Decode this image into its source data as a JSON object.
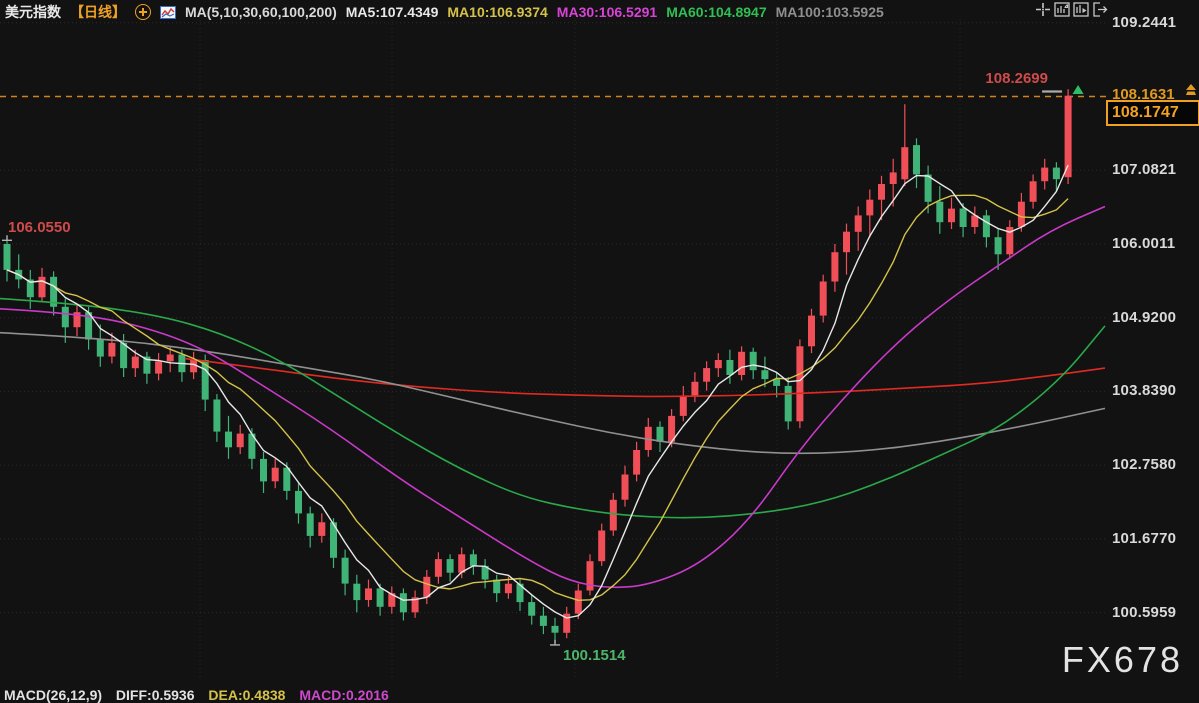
{
  "header": {
    "symbol": "美元指数",
    "period": "【日线】",
    "ma_group": "MA(5,10,30,60,100,200)",
    "ma5": "MA5:107.4349",
    "ma10": "MA10:106.9374",
    "ma30": "MA30:106.5291",
    "ma60": "MA60:104.8947",
    "ma100": "MA100:103.5925"
  },
  "colors": {
    "accent_orange": "#f0a125",
    "ma5": "#e8e8e8",
    "ma10": "#d4c24a",
    "ma30": "#c93ac9",
    "ma60": "#2aa94a",
    "ma100": "#909090",
    "ma200": "#e02a22",
    "candle_up": "#f14f58",
    "candle_down": "#40b376"
  },
  "toolbar": {
    "icons": [
      "crosshair",
      "indicator-panel",
      "playback",
      "exit"
    ]
  },
  "axis": {
    "alert_label": "108.1631",
    "price_box": "108.1747"
  },
  "footer": {
    "macd_label": "MACD(26,12,9)",
    "diff": "DIFF:0.5936",
    "dea": "DEA:0.4838",
    "macd": "MACD:0.2016"
  },
  "watermark": "FX678",
  "chart_data": {
    "type": "candlestick",
    "title": "美元指数 日线 (US Dollar Index, daily)",
    "ylim": [
      100.0,
      109.6
    ],
    "grid": true,
    "legend_position": "top",
    "y_ticks": [
      {
        "label": "109.2441",
        "price": 109.2441
      },
      {
        "label": "108.1631",
        "price": 108.1631
      },
      {
        "label": "107.0821",
        "price": 107.0821
      },
      {
        "label": "106.0011",
        "price": 106.0011
      },
      {
        "label": "104.9200",
        "price": 104.92
      },
      {
        "label": "103.8390",
        "price": 103.839
      },
      {
        "label": "102.7580",
        "price": 102.758
      },
      {
        "label": "101.6770",
        "price": 101.677
      },
      {
        "label": "100.5959",
        "price": 100.5959
      }
    ],
    "price_line": {
      "price": 108.1631,
      "label": "108.1631"
    },
    "last_price": {
      "value": 108.1747,
      "label": "108.1747"
    },
    "colors": {
      "up": "#f14f58",
      "down": "#40b376"
    },
    "candles": [
      [
        106.0,
        106.055,
        105.45,
        105.62
      ],
      [
        105.62,
        105.85,
        105.35,
        105.48
      ],
      [
        105.48,
        105.62,
        105.05,
        105.22
      ],
      [
        105.22,
        105.65,
        105.15,
        105.52
      ],
      [
        105.52,
        105.6,
        104.95,
        105.08
      ],
      [
        105.08,
        105.2,
        104.55,
        104.78
      ],
      [
        104.78,
        105.1,
        104.65,
        105.0
      ],
      [
        105.0,
        105.08,
        104.45,
        104.6
      ],
      [
        104.6,
        104.82,
        104.2,
        104.35
      ],
      [
        104.35,
        104.7,
        104.25,
        104.55
      ],
      [
        104.55,
        104.68,
        104.05,
        104.18
      ],
      [
        104.18,
        104.45,
        104.05,
        104.35
      ],
      [
        104.35,
        104.42,
        103.95,
        104.1
      ],
      [
        104.1,
        104.4,
        104.0,
        104.28
      ],
      [
        104.28,
        104.5,
        104.12,
        104.38
      ],
      [
        104.38,
        104.45,
        103.98,
        104.12
      ],
      [
        104.12,
        104.42,
        104.02,
        104.3
      ],
      [
        104.3,
        104.38,
        103.55,
        103.72
      ],
      [
        103.72,
        103.8,
        103.1,
        103.25
      ],
      [
        103.25,
        103.48,
        102.85,
        103.02
      ],
      [
        103.02,
        103.35,
        102.92,
        103.22
      ],
      [
        103.22,
        103.3,
        102.7,
        102.85
      ],
      [
        102.85,
        102.95,
        102.35,
        102.52
      ],
      [
        102.52,
        102.85,
        102.42,
        102.72
      ],
      [
        102.72,
        102.8,
        102.25,
        102.38
      ],
      [
        102.38,
        102.5,
        101.9,
        102.05
      ],
      [
        102.05,
        102.15,
        101.55,
        101.72
      ],
      [
        101.72,
        102.05,
        101.62,
        101.92
      ],
      [
        101.92,
        101.98,
        101.25,
        101.4
      ],
      [
        101.4,
        101.52,
        100.85,
        101.02
      ],
      [
        101.02,
        101.15,
        100.6,
        100.78
      ],
      [
        100.78,
        101.08,
        100.68,
        100.95
      ],
      [
        100.95,
        101.02,
        100.55,
        100.68
      ],
      [
        100.68,
        100.98,
        100.58,
        100.88
      ],
      [
        100.88,
        100.95,
        100.48,
        100.6
      ],
      [
        100.6,
        100.92,
        100.52,
        100.82
      ],
      [
        100.82,
        101.22,
        100.72,
        101.12
      ],
      [
        101.12,
        101.48,
        101.02,
        101.38
      ],
      [
        101.38,
        101.45,
        101.05,
        101.18
      ],
      [
        101.18,
        101.55,
        101.1,
        101.45
      ],
      [
        101.45,
        101.52,
        101.15,
        101.28
      ],
      [
        101.28,
        101.38,
        100.95,
        101.08
      ],
      [
        101.08,
        101.15,
        100.75,
        100.88
      ],
      [
        100.88,
        101.12,
        100.8,
        101.02
      ],
      [
        101.02,
        101.08,
        100.62,
        100.75
      ],
      [
        100.75,
        100.85,
        100.42,
        100.55
      ],
      [
        100.55,
        100.68,
        100.28,
        100.4
      ],
      [
        100.4,
        100.52,
        100.1514,
        100.3
      ],
      [
        100.3,
        100.68,
        100.22,
        100.58
      ],
      [
        100.58,
        101.02,
        100.5,
        100.92
      ],
      [
        100.92,
        101.45,
        100.85,
        101.35
      ],
      [
        101.35,
        101.9,
        101.28,
        101.8
      ],
      [
        101.8,
        102.35,
        101.72,
        102.25
      ],
      [
        102.25,
        102.75,
        102.15,
        102.62
      ],
      [
        102.62,
        103.1,
        102.52,
        102.98
      ],
      [
        102.98,
        103.45,
        102.88,
        103.32
      ],
      [
        103.32,
        103.4,
        102.95,
        103.1
      ],
      [
        103.1,
        103.58,
        103.02,
        103.48
      ],
      [
        103.48,
        103.92,
        103.4,
        103.78
      ],
      [
        103.78,
        104.12,
        103.68,
        103.98
      ],
      [
        103.98,
        104.28,
        103.85,
        104.18
      ],
      [
        104.18,
        104.4,
        104.05,
        104.3
      ],
      [
        104.3,
        104.45,
        103.95,
        104.08
      ],
      [
        104.08,
        104.5,
        104.0,
        104.42
      ],
      [
        104.42,
        104.48,
        104.02,
        104.15
      ],
      [
        104.15,
        104.35,
        103.9,
        104.02
      ],
      [
        104.02,
        104.12,
        103.75,
        103.92
      ],
      [
        103.92,
        104.05,
        103.28,
        103.4
      ],
      [
        103.4,
        104.6,
        103.3,
        104.5
      ],
      [
        104.5,
        105.05,
        104.4,
        104.95
      ],
      [
        104.95,
        105.55,
        104.85,
        105.45
      ],
      [
        105.45,
        106.0,
        105.3,
        105.88
      ],
      [
        105.88,
        106.3,
        105.55,
        106.18
      ],
      [
        106.18,
        106.55,
        105.9,
        106.42
      ],
      [
        106.42,
        106.8,
        106.1,
        106.65
      ],
      [
        106.65,
        107.0,
        106.35,
        106.88
      ],
      [
        106.88,
        107.25,
        106.55,
        107.05
      ],
      [
        106.95,
        108.05,
        106.85,
        107.42
      ],
      [
        107.45,
        107.55,
        106.82,
        107.02
      ],
      [
        107.02,
        107.15,
        106.45,
        106.62
      ],
      [
        106.62,
        106.85,
        106.15,
        106.32
      ],
      [
        106.32,
        106.68,
        106.22,
        106.52
      ],
      [
        106.52,
        106.6,
        106.1,
        106.25
      ],
      [
        106.25,
        106.55,
        106.15,
        106.42
      ],
      [
        106.42,
        106.5,
        105.95,
        106.1
      ],
      [
        106.1,
        106.22,
        105.62,
        105.85
      ],
      [
        105.85,
        106.35,
        105.78,
        106.25
      ],
      [
        106.25,
        106.75,
        106.18,
        106.62
      ],
      [
        106.62,
        107.02,
        106.52,
        106.92
      ],
      [
        106.92,
        107.25,
        106.8,
        107.12
      ],
      [
        107.12,
        107.2,
        106.78,
        106.95
      ],
      [
        106.98,
        108.2699,
        106.88,
        108.1747
      ]
    ],
    "computed_ma": [
      {
        "name": "MA10",
        "window": 10,
        "color": "#d4c24a"
      },
      {
        "name": "MA5",
        "window": 5,
        "color": "#e8e8e8"
      }
    ],
    "ma_overlays": [
      {
        "name": "MA200",
        "color": "#e02a22",
        "points": [
          [
            185,
            104.32
          ],
          [
            260,
            104.18
          ],
          [
            340,
            104.02
          ],
          [
            420,
            103.9
          ],
          [
            500,
            103.82
          ],
          [
            580,
            103.78
          ],
          [
            660,
            103.76
          ],
          [
            740,
            103.78
          ],
          [
            820,
            103.82
          ],
          [
            900,
            103.88
          ],
          [
            980,
            103.95
          ],
          [
            1040,
            104.05
          ],
          [
            1105,
            104.18
          ]
        ]
      },
      {
        "name": "MA100",
        "color": "#909090",
        "points": [
          [
            0,
            104.7
          ],
          [
            100,
            104.62
          ],
          [
            200,
            104.45
          ],
          [
            300,
            104.2
          ],
          [
            380,
            104.0
          ],
          [
            460,
            103.72
          ],
          [
            540,
            103.45
          ],
          [
            620,
            103.2
          ],
          [
            700,
            103.02
          ],
          [
            780,
            102.92
          ],
          [
            860,
            102.95
          ],
          [
            940,
            103.1
          ],
          [
            1020,
            103.32
          ],
          [
            1105,
            103.59
          ]
        ]
      },
      {
        "name": "MA60",
        "color": "#2aa94a",
        "points": [
          [
            0,
            105.2
          ],
          [
            80,
            105.12
          ],
          [
            160,
            104.95
          ],
          [
            220,
            104.7
          ],
          [
            280,
            104.3
          ],
          [
            340,
            103.75
          ],
          [
            400,
            103.2
          ],
          [
            460,
            102.7
          ],
          [
            520,
            102.3
          ],
          [
            580,
            102.1
          ],
          [
            640,
            102.0
          ],
          [
            700,
            101.98
          ],
          [
            760,
            102.05
          ],
          [
            820,
            102.2
          ],
          [
            880,
            102.5
          ],
          [
            940,
            102.9
          ],
          [
            1000,
            103.3
          ],
          [
            1060,
            104.0
          ],
          [
            1105,
            104.8
          ]
        ]
      },
      {
        "name": "MA30",
        "color": "#c93ac9",
        "points": [
          [
            0,
            105.05
          ],
          [
            60,
            105.0
          ],
          [
            130,
            104.85
          ],
          [
            200,
            104.5
          ],
          [
            260,
            103.95
          ],
          [
            330,
            103.3
          ],
          [
            400,
            102.55
          ],
          [
            470,
            101.9
          ],
          [
            530,
            101.35
          ],
          [
            570,
            101.05
          ],
          [
            610,
            100.95
          ],
          [
            650,
            101.0
          ],
          [
            700,
            101.3
          ],
          [
            750,
            101.95
          ],
          [
            800,
            103.0
          ],
          [
            850,
            103.85
          ],
          [
            900,
            104.6
          ],
          [
            950,
            105.2
          ],
          [
            1000,
            105.7
          ],
          [
            1050,
            106.2
          ],
          [
            1105,
            106.55
          ]
        ]
      }
    ],
    "annotations": {
      "left_high": {
        "text": "106.0550",
        "candle": 0,
        "price": 106.055,
        "color": "#cf4b4b"
      },
      "low": {
        "text": "100.1514",
        "candle": 47,
        "price": 100.1514,
        "color": "#4db56a"
      },
      "right_high": {
        "text": "108.2699",
        "candle": 91,
        "price": 108.2699,
        "color": "#cf4b4b"
      }
    }
  }
}
